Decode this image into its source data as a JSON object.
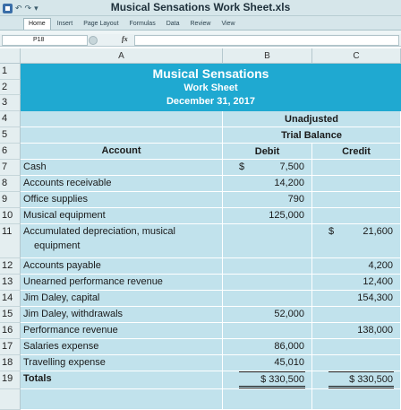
{
  "window": {
    "title": "Musical Sensations Work Sheet.xls"
  },
  "ribbon": {
    "tabs": [
      "Home",
      "Insert",
      "Page Layout",
      "Formulas",
      "Data",
      "Review",
      "View"
    ],
    "active_tab": "Home"
  },
  "formula_bar": {
    "name_box": "P18",
    "fx": "fx",
    "value": ""
  },
  "columns": [
    "A",
    "B",
    "C"
  ],
  "sheet": {
    "company": "Musical Sensations",
    "report": "Work Sheet",
    "date": "December 31, 2017",
    "group_header_1": "Unadjusted",
    "group_header_2": "Trial Balance",
    "account_header": "Account",
    "debit_header": "Debit",
    "credit_header": "Credit",
    "rows": [
      {
        "num": "7",
        "account": "Cash",
        "debit_sign": "$",
        "debit": "7,500",
        "credit_sign": "",
        "credit": ""
      },
      {
        "num": "8",
        "account": "Accounts receivable",
        "debit_sign": "",
        "debit": "14,200",
        "credit_sign": "",
        "credit": ""
      },
      {
        "num": "9",
        "account": "Office supplies",
        "debit_sign": "",
        "debit": "790",
        "credit_sign": "",
        "credit": ""
      },
      {
        "num": "10",
        "account": "Musical equipment",
        "debit_sign": "",
        "debit": "125,000",
        "credit_sign": "",
        "credit": ""
      },
      {
        "num": "11",
        "account": "Accumulated depreciation, musical",
        "account_2": "equipment",
        "debit_sign": "",
        "debit": "",
        "credit_sign": "$",
        "credit": "21,600"
      },
      {
        "num": "12",
        "account": "Accounts payable",
        "debit_sign": "",
        "debit": "",
        "credit_sign": "",
        "credit": "4,200"
      },
      {
        "num": "13",
        "account": "Unearned performance revenue",
        "debit_sign": "",
        "debit": "",
        "credit_sign": "",
        "credit": "12,400"
      },
      {
        "num": "14",
        "account": "Jim Daley, capital",
        "debit_sign": "",
        "debit": "",
        "credit_sign": "",
        "credit": "154,300"
      },
      {
        "num": "15",
        "account": "Jim Daley, withdrawals",
        "debit_sign": "",
        "debit": "52,000",
        "credit_sign": "",
        "credit": ""
      },
      {
        "num": "16",
        "account": "Performance revenue",
        "debit_sign": "",
        "debit": "",
        "credit_sign": "",
        "credit": "138,000"
      },
      {
        "num": "17",
        "account": "Salaries expense",
        "debit_sign": "",
        "debit": "86,000",
        "credit_sign": "",
        "credit": ""
      },
      {
        "num": "18",
        "account": "Travelling expense",
        "debit_sign": "",
        "debit": "45,010",
        "credit_sign": "",
        "credit": ""
      }
    ],
    "totals": {
      "num": "19",
      "label": "Totals",
      "debit": "$ 330,500",
      "credit": "$ 330,500"
    }
  },
  "colors": {
    "banner": "#1fa9d1",
    "cell_fill": "#c1e2ec",
    "header_fill": "#e4eef0",
    "chrome": "#d6e6ea"
  }
}
